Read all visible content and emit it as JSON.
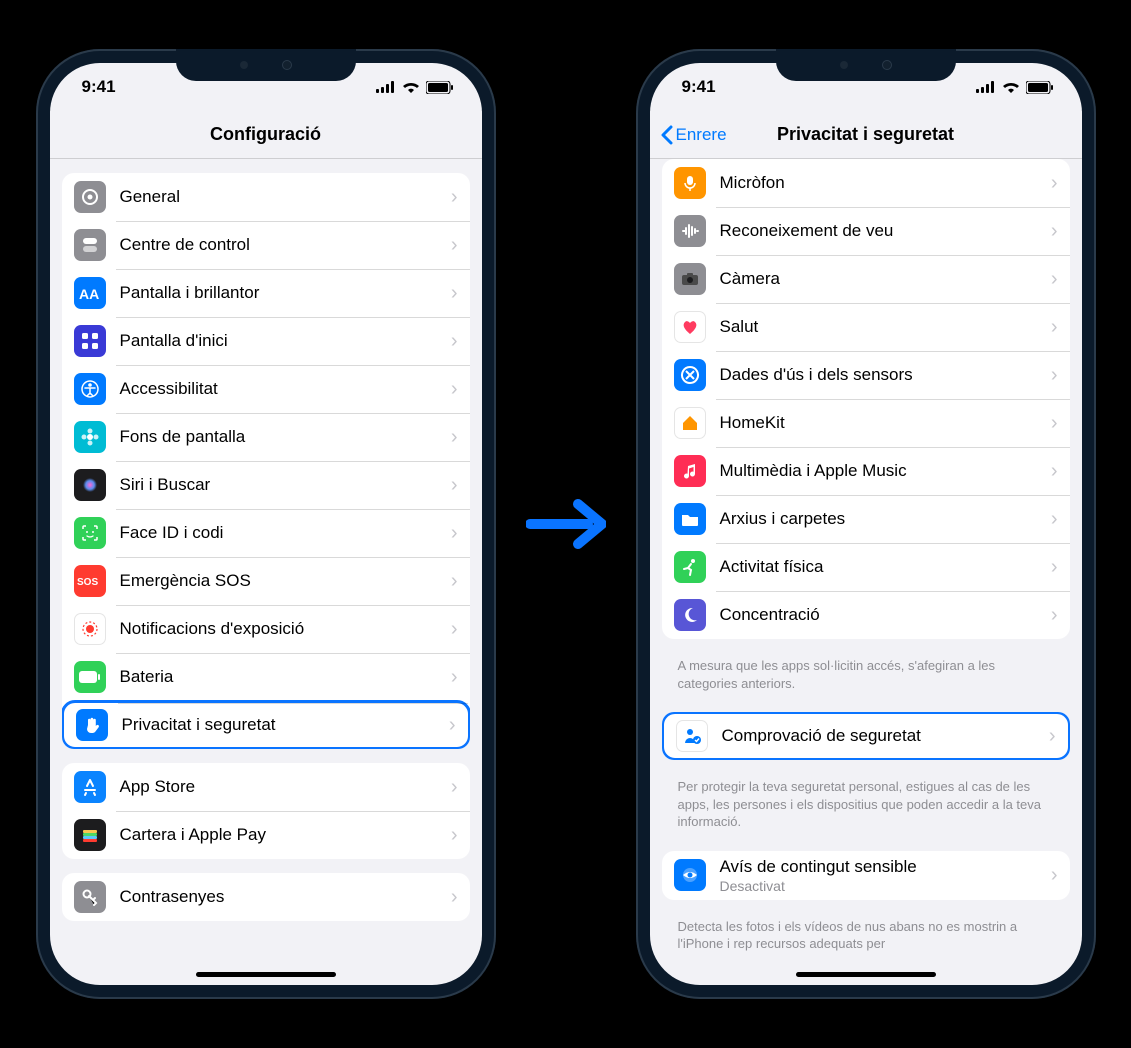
{
  "status": {
    "time": "9:41"
  },
  "arrow_color": "#0a74ff",
  "phone1": {
    "title": "Configuració",
    "group1": [
      {
        "name": "general",
        "label": "General",
        "icon": "gear",
        "bg": "#8e8e93"
      },
      {
        "name": "control-center",
        "label": "Centre de control",
        "icon": "toggles",
        "bg": "#8e8e93"
      },
      {
        "name": "display",
        "label": "Pantalla i brillantor",
        "icon": "aa",
        "bg": "#007aff"
      },
      {
        "name": "home-screen",
        "label": "Pantalla d'inici",
        "icon": "grid",
        "bg": "#3a3ad6"
      },
      {
        "name": "accessibility",
        "label": "Accessibilitat",
        "icon": "accessibility",
        "bg": "#007aff"
      },
      {
        "name": "wallpaper",
        "label": "Fons de pantalla",
        "icon": "flower",
        "bg": "#00bcd4"
      },
      {
        "name": "siri",
        "label": "Siri i Buscar",
        "icon": "siri",
        "bg": "#1c1c1e"
      },
      {
        "name": "faceid",
        "label": "Face ID i codi",
        "icon": "faceid",
        "bg": "#30d158"
      },
      {
        "name": "sos",
        "label": "Emergència SOS",
        "icon": "sos",
        "bg": "#ff3b30"
      },
      {
        "name": "exposure",
        "label": "Notificacions d'exposició",
        "icon": "exposure",
        "bg": "#ffffff"
      },
      {
        "name": "battery",
        "label": "Bateria",
        "icon": "battery",
        "bg": "#30d158"
      },
      {
        "name": "privacy",
        "label": "Privacitat i seguretat",
        "icon": "hand",
        "bg": "#007aff",
        "highlight": true
      }
    ],
    "group2": [
      {
        "name": "appstore",
        "label": "App Store",
        "icon": "appstore",
        "bg": "#0a84ff"
      },
      {
        "name": "wallet",
        "label": "Cartera i Apple Pay",
        "icon": "wallet",
        "bg": "#1c1c1e"
      }
    ],
    "group3": [
      {
        "name": "passwords",
        "label": "Contrasenyes",
        "icon": "key",
        "bg": "#8e8e93"
      }
    ]
  },
  "phone2": {
    "back": "Enrere",
    "title": "Privacitat i seguretat",
    "group1": [
      {
        "name": "microphone",
        "label": "Micròfon",
        "icon": "mic",
        "bg": "#ff9500"
      },
      {
        "name": "speech",
        "label": "Reconeixement de veu",
        "icon": "wave",
        "bg": "#8e8e93"
      },
      {
        "name": "camera",
        "label": "Càmera",
        "icon": "camera",
        "bg": "#8e8e93"
      },
      {
        "name": "health",
        "label": "Salut",
        "icon": "heart",
        "bg": "#ffffff"
      },
      {
        "name": "research",
        "label": "Dades d'ús i dels sensors",
        "icon": "research",
        "bg": "#027aff"
      },
      {
        "name": "homekit",
        "label": "HomeKit",
        "icon": "home",
        "bg": "#ffffff"
      },
      {
        "name": "media",
        "label": "Multimèdia i Apple Music",
        "icon": "music",
        "bg": "#ff2d55"
      },
      {
        "name": "files",
        "label": "Arxius i carpetes",
        "icon": "folder",
        "bg": "#007aff"
      },
      {
        "name": "motion",
        "label": "Activitat física",
        "icon": "motion",
        "bg": "#30d158"
      },
      {
        "name": "focus",
        "label": "Concentració",
        "icon": "moon",
        "bg": "#5856d6"
      }
    ],
    "footer1": "A mesura que les apps sol·licitin accés, s'afegiran a les categories anteriors.",
    "group2": [
      {
        "name": "safety-check",
        "label": "Comprovació de seguretat",
        "icon": "person-check",
        "bg": "#ffffff",
        "highlight": true
      }
    ],
    "footer2": "Per protegir la teva seguretat personal, estigues al cas de les apps, les persones i els dispositius que poden accedir a la teva informació.",
    "group3": [
      {
        "name": "sensitive",
        "label": "Avís de contingut sensible",
        "sublabel": "Desactivat",
        "icon": "eye",
        "bg": "#007aff"
      }
    ],
    "footer3": "Detecta les fotos i els vídeos de nus abans no es mostrin a l'iPhone i rep recursos adequats per"
  }
}
